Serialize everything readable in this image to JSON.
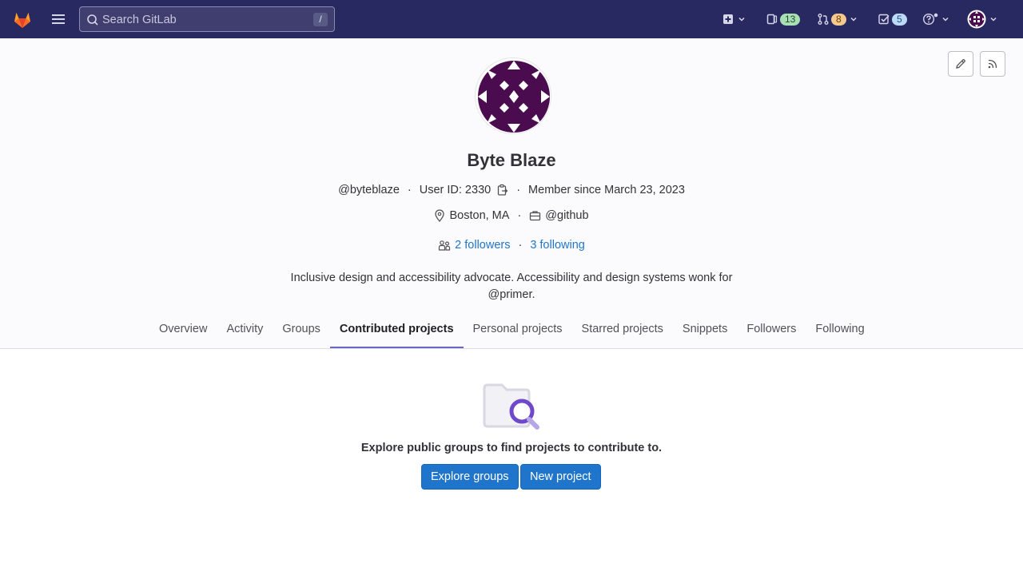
{
  "topbar": {
    "search_placeholder": "Search GitLab",
    "search_shortcut": "/",
    "issues_count": "13",
    "merge_requests_count": "8",
    "todos_count": "5",
    "brand_color": "#292961"
  },
  "profile": {
    "name": "Byte Blaze",
    "username": "@byteblaze",
    "user_id_label": "User ID: 2330",
    "member_since": "Member since March 23, 2023",
    "location": "Boston, MA",
    "organization": "@github",
    "followers": "2 followers",
    "following": "3 following",
    "bio": "Inclusive design and accessibility advocate. Accessibility and design systems wonk for @primer."
  },
  "tabs": [
    {
      "label": "Overview"
    },
    {
      "label": "Activity"
    },
    {
      "label": "Groups"
    },
    {
      "label": "Contributed projects"
    },
    {
      "label": "Personal projects"
    },
    {
      "label": "Starred projects"
    },
    {
      "label": "Snippets"
    },
    {
      "label": "Followers"
    },
    {
      "label": "Following"
    }
  ],
  "active_tab": "Contributed projects",
  "empty_state": {
    "message": "Explore public groups to find projects to contribute to.",
    "explore_button": "Explore groups",
    "new_project_button": "New project"
  },
  "icons": {
    "logo": "gitlab-tanuki-icon",
    "menu": "hamburger-icon",
    "create": "plus-square-icon",
    "issues": "issues-icon",
    "merge_requests": "merge-request-icon",
    "todos": "todo-check-icon",
    "help": "question-icon",
    "edit": "pencil-icon",
    "rss": "rss-icon",
    "location": "location-pin-icon",
    "organization": "briefcase-icon",
    "followers": "users-icon",
    "copy": "copy-icon"
  },
  "colors": {
    "link": "#1f75cb",
    "primary_button": "#1f75cb",
    "active_tab_underline": "#6666c4",
    "avatar": "#4a0b4f"
  }
}
